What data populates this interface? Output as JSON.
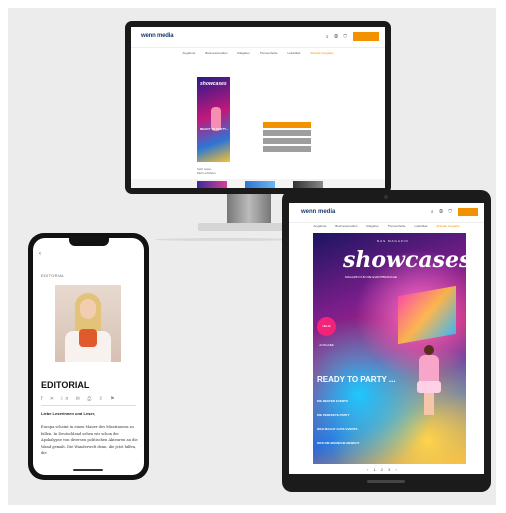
{
  "desktop": {
    "logo": "wenn media",
    "icons": [
      "search-icon",
      "user-icon",
      "cart-icon"
    ],
    "nav": [
      "Angebote",
      "Businessmedien",
      "Ratgeber",
      "Themenhefte",
      "Leitartikel",
      "Aktuelle Ausgabe"
    ],
    "cover_title": "showcases",
    "cover_headline": "READY TO PARTY...",
    "caption": [
      "Sehr lesen",
      "Mehr erfahren"
    ]
  },
  "tablet": {
    "logo": "wenn media",
    "icons": [
      "search-icon",
      "user-icon",
      "cart-icon"
    ],
    "nav": [
      "Angebote",
      "Businessmedien",
      "Ratgeber",
      "Themenhefte",
      "Leitartikel",
      "Aktuelle Ausgabe"
    ],
    "cover": {
      "kicker": "DAS MAGAZIN",
      "title": "showcases",
      "subtitle": "MAGAZIN FÜR DIE EVENTBRANCHE",
      "badge": "NEUE AUSGABE",
      "heading": "READY TO PARTY ...",
      "teasers": [
        "DIE BESTEN EVENTS",
        "DIE PERFEKTE PARTY",
        "WAS MACHT GUTE EVENTS",
        "WAS DIE BRANCHE BEWEGT"
      ]
    },
    "pager": "‹ 1 2 3 ›"
  },
  "phone": {
    "back": "‹",
    "section": "EDITORIAL",
    "heading": "EDITORIAL",
    "share_icons": [
      "facebook-icon",
      "twitter-icon",
      "linkedin-icon",
      "mail-icon",
      "print-icon",
      "share-icon",
      "bookmark-icon"
    ],
    "greeting": "Liebe Leserinnen und Leser,",
    "body": "Europa scheint in einen Mauer des Misstrauens zu fallen. In Deutschland sehen wir schon die Apokalypse von diversen politischen Akteuren an die Wand gemalt. Die Wanderwelt denn, die jetzt hilfen, die"
  }
}
